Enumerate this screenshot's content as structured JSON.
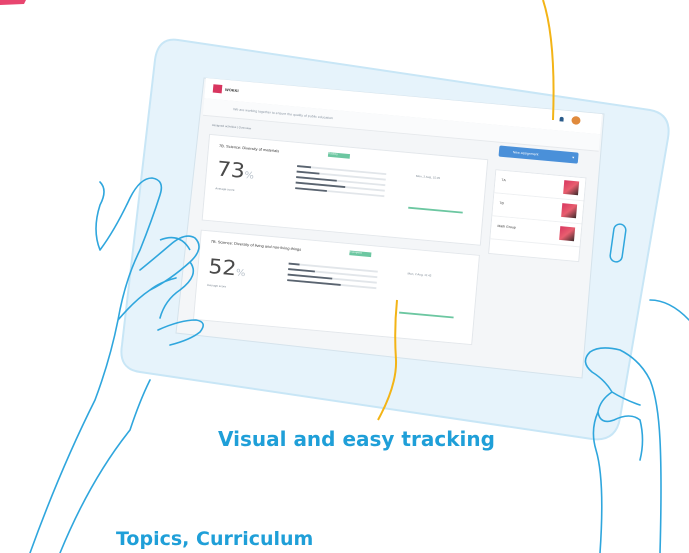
{
  "captions": {
    "main": "Visual and easy tracking",
    "bottom": "Topics, Curriculum"
  },
  "screen": {
    "logo": "WOKKI",
    "subtitle": "We are working together to ensure the quality of public education",
    "new_button": "New assignment",
    "breadcrumb": "Assigned activities | Overview",
    "cards": [
      {
        "title": "7B. Science: Diversity of materials",
        "tag": "Tracking",
        "due": "Mon, 2 Aug, 15:45",
        "percent": "73",
        "unit": "%",
        "label": "Average score",
        "bars": [
          0.15,
          0.25,
          0.45,
          0.55,
          0.35
        ]
      },
      {
        "title": "7B. Science: Diversity of living and non-living things",
        "tag": "In progress",
        "due": "Mon, 2 Aug, 11:45",
        "percent": "52",
        "unit": "%",
        "label": "Average score",
        "bars": [
          0.12,
          0.3,
          0.5,
          0.6
        ]
      }
    ],
    "groups": [
      "7A",
      "7B",
      "Math Group"
    ]
  },
  "colors": {
    "caption": "#1f9fd8",
    "line": "#f3b416",
    "accent": "#d8355f",
    "outline": "#2fa6dd"
  }
}
